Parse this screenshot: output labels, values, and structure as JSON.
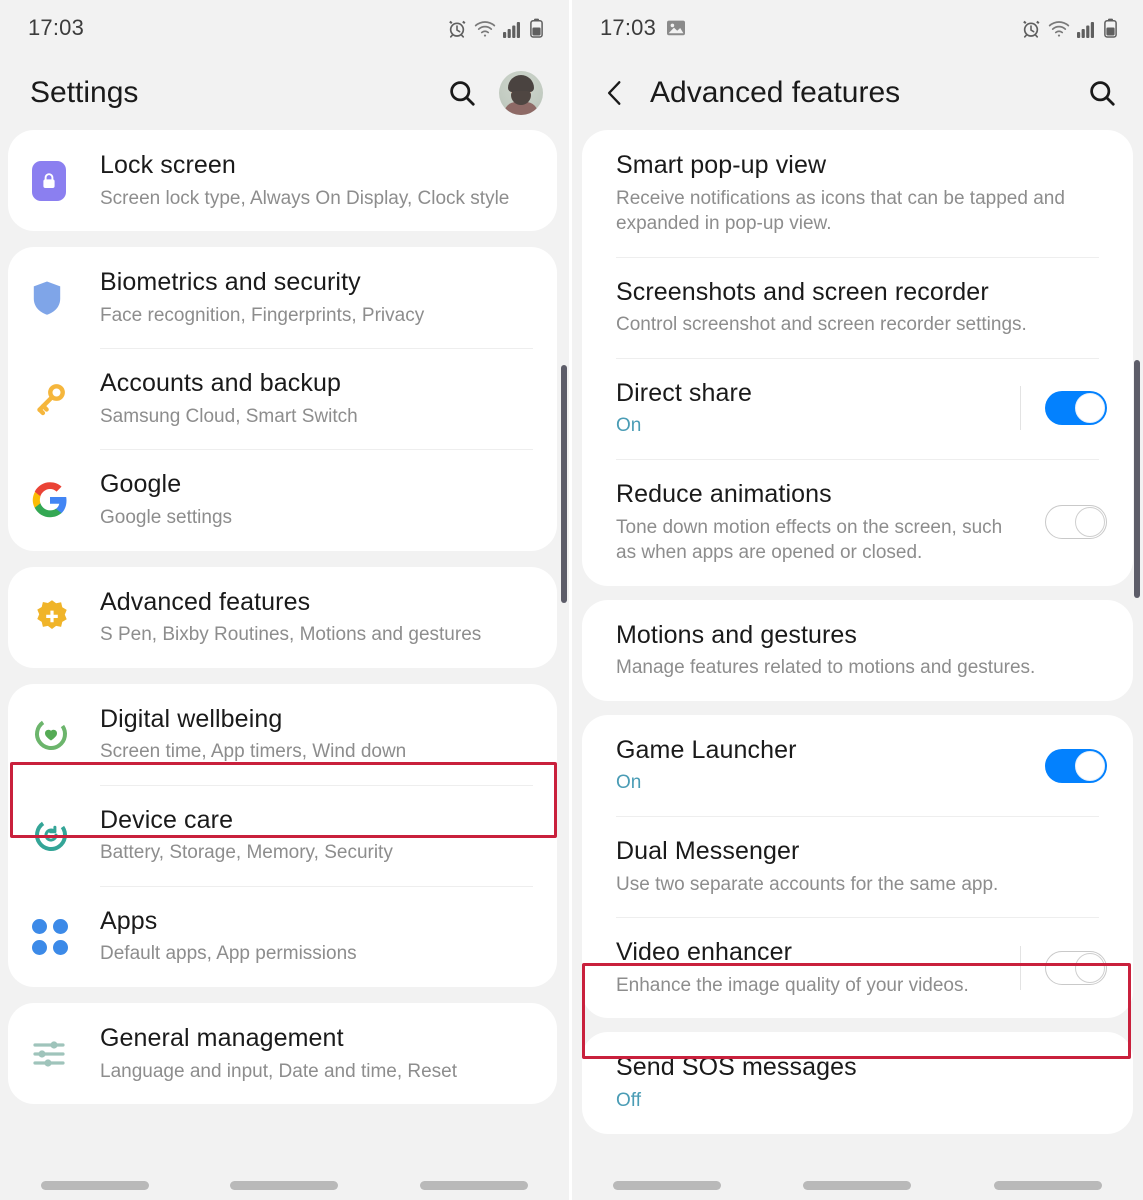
{
  "left": {
    "statusbar": {
      "time": "17:03",
      "icons": [
        "alarm-icon",
        "wifi-icon",
        "signal-icon",
        "battery-icon"
      ]
    },
    "header": {
      "title": "Settings",
      "search_icon": "search-icon",
      "avatar": "avatar"
    },
    "groups": [
      {
        "items": [
          {
            "icon": "lock-icon",
            "title": "Lock screen",
            "subtitle": "Screen lock type, Always On Display, Clock style"
          }
        ]
      },
      {
        "items": [
          {
            "icon": "shield-icon",
            "title": "Biometrics and security",
            "subtitle": "Face recognition, Fingerprints, Privacy"
          },
          {
            "icon": "key-icon",
            "title": "Accounts and backup",
            "subtitle": "Samsung Cloud, Smart Switch"
          },
          {
            "icon": "google-icon",
            "title": "Google",
            "subtitle": "Google settings"
          }
        ]
      },
      {
        "highlighted": true,
        "items": [
          {
            "icon": "gear-flower-icon",
            "title": "Advanced features",
            "subtitle": "S Pen, Bixby Routines, Motions and gestures"
          }
        ]
      },
      {
        "items": [
          {
            "icon": "wellbeing-icon",
            "title": "Digital wellbeing",
            "subtitle": "Screen time, App timers, Wind down"
          },
          {
            "icon": "device-care-icon",
            "title": "Device care",
            "subtitle": "Battery, Storage, Memory, Security"
          },
          {
            "icon": "apps-grid-icon",
            "title": "Apps",
            "subtitle": "Default apps, App permissions"
          }
        ]
      },
      {
        "items": [
          {
            "icon": "sliders-icon",
            "title": "General management",
            "subtitle": "Language and input, Date and time, Reset"
          }
        ]
      }
    ]
  },
  "right": {
    "statusbar": {
      "time": "17:03",
      "notification_icon": "image-icon",
      "icons": [
        "alarm-icon",
        "wifi-icon",
        "signal-icon",
        "battery-icon"
      ]
    },
    "header": {
      "back_icon": "back-chevron-icon",
      "title": "Advanced features",
      "search_icon": "search-icon"
    },
    "groups": [
      {
        "items": [
          {
            "title": "Smart pop-up view",
            "subtitle": "Receive notifications as icons that can be tapped and expanded in pop-up view.",
            "toggle": null
          },
          {
            "title": "Screenshots and screen recorder",
            "subtitle": "Control screenshot and screen recorder settings.",
            "toggle": null
          },
          {
            "title": "Direct share",
            "subtitle": "On",
            "state_text": true,
            "toggle": "on"
          },
          {
            "title": "Reduce animations",
            "subtitle": "Tone down motion effects on the screen, such as when apps are opened or closed.",
            "toggle": "off"
          }
        ]
      },
      {
        "items": [
          {
            "title": "Motions and gestures",
            "subtitle": "Manage features related to motions and gestures.",
            "toggle": null
          }
        ]
      },
      {
        "items": [
          {
            "title": "Game Launcher",
            "subtitle": "On",
            "state_text": true,
            "toggle": "on"
          },
          {
            "title": "Dual Messenger",
            "subtitle": "Use two separate accounts for the same app.",
            "toggle": null,
            "highlighted": true
          },
          {
            "title": "Video enhancer",
            "subtitle": "Enhance the image quality of your videos.",
            "toggle": "off"
          }
        ]
      },
      {
        "items": [
          {
            "title": "Send SOS messages",
            "subtitle": "Off",
            "state_text": true,
            "toggle": null
          }
        ]
      }
    ]
  },
  "colors": {
    "toggle_on": "#0381fe",
    "highlight_box": "#c9203c",
    "state_text": "#4a9cb5",
    "page_bg": "#f2f2f2",
    "card_bg": "#ffffff"
  }
}
